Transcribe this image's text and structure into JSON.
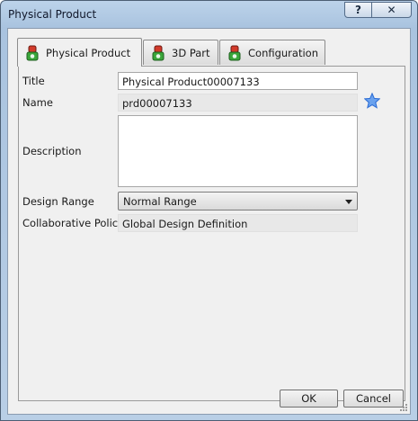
{
  "window": {
    "title": "Physical Product",
    "help_label": "?",
    "close_label": "✕"
  },
  "tabs": [
    {
      "label": "Physical Product",
      "icon": "physical-product-icon",
      "active": true
    },
    {
      "label": "3D Part",
      "icon": "3d-part-icon",
      "active": false
    },
    {
      "label": "Configuration",
      "icon": "configuration-icon",
      "active": false
    }
  ],
  "form": {
    "title": {
      "label": "Title",
      "value": "Physical Product00007133"
    },
    "name": {
      "label": "Name",
      "value": "prd00007133"
    },
    "description": {
      "label": "Description",
      "value": ""
    },
    "design_range": {
      "label": "Design Range",
      "value": "Normal Range"
    },
    "collaborative_policy": {
      "label": "Collaborative Policy",
      "value": "Global Design Definition"
    }
  },
  "buttons": {
    "ok": "OK",
    "cancel": "Cancel"
  },
  "colors": {
    "star": "#2f6fd6",
    "icon_green": "#3aa63a",
    "icon_red": "#d23a2a"
  }
}
